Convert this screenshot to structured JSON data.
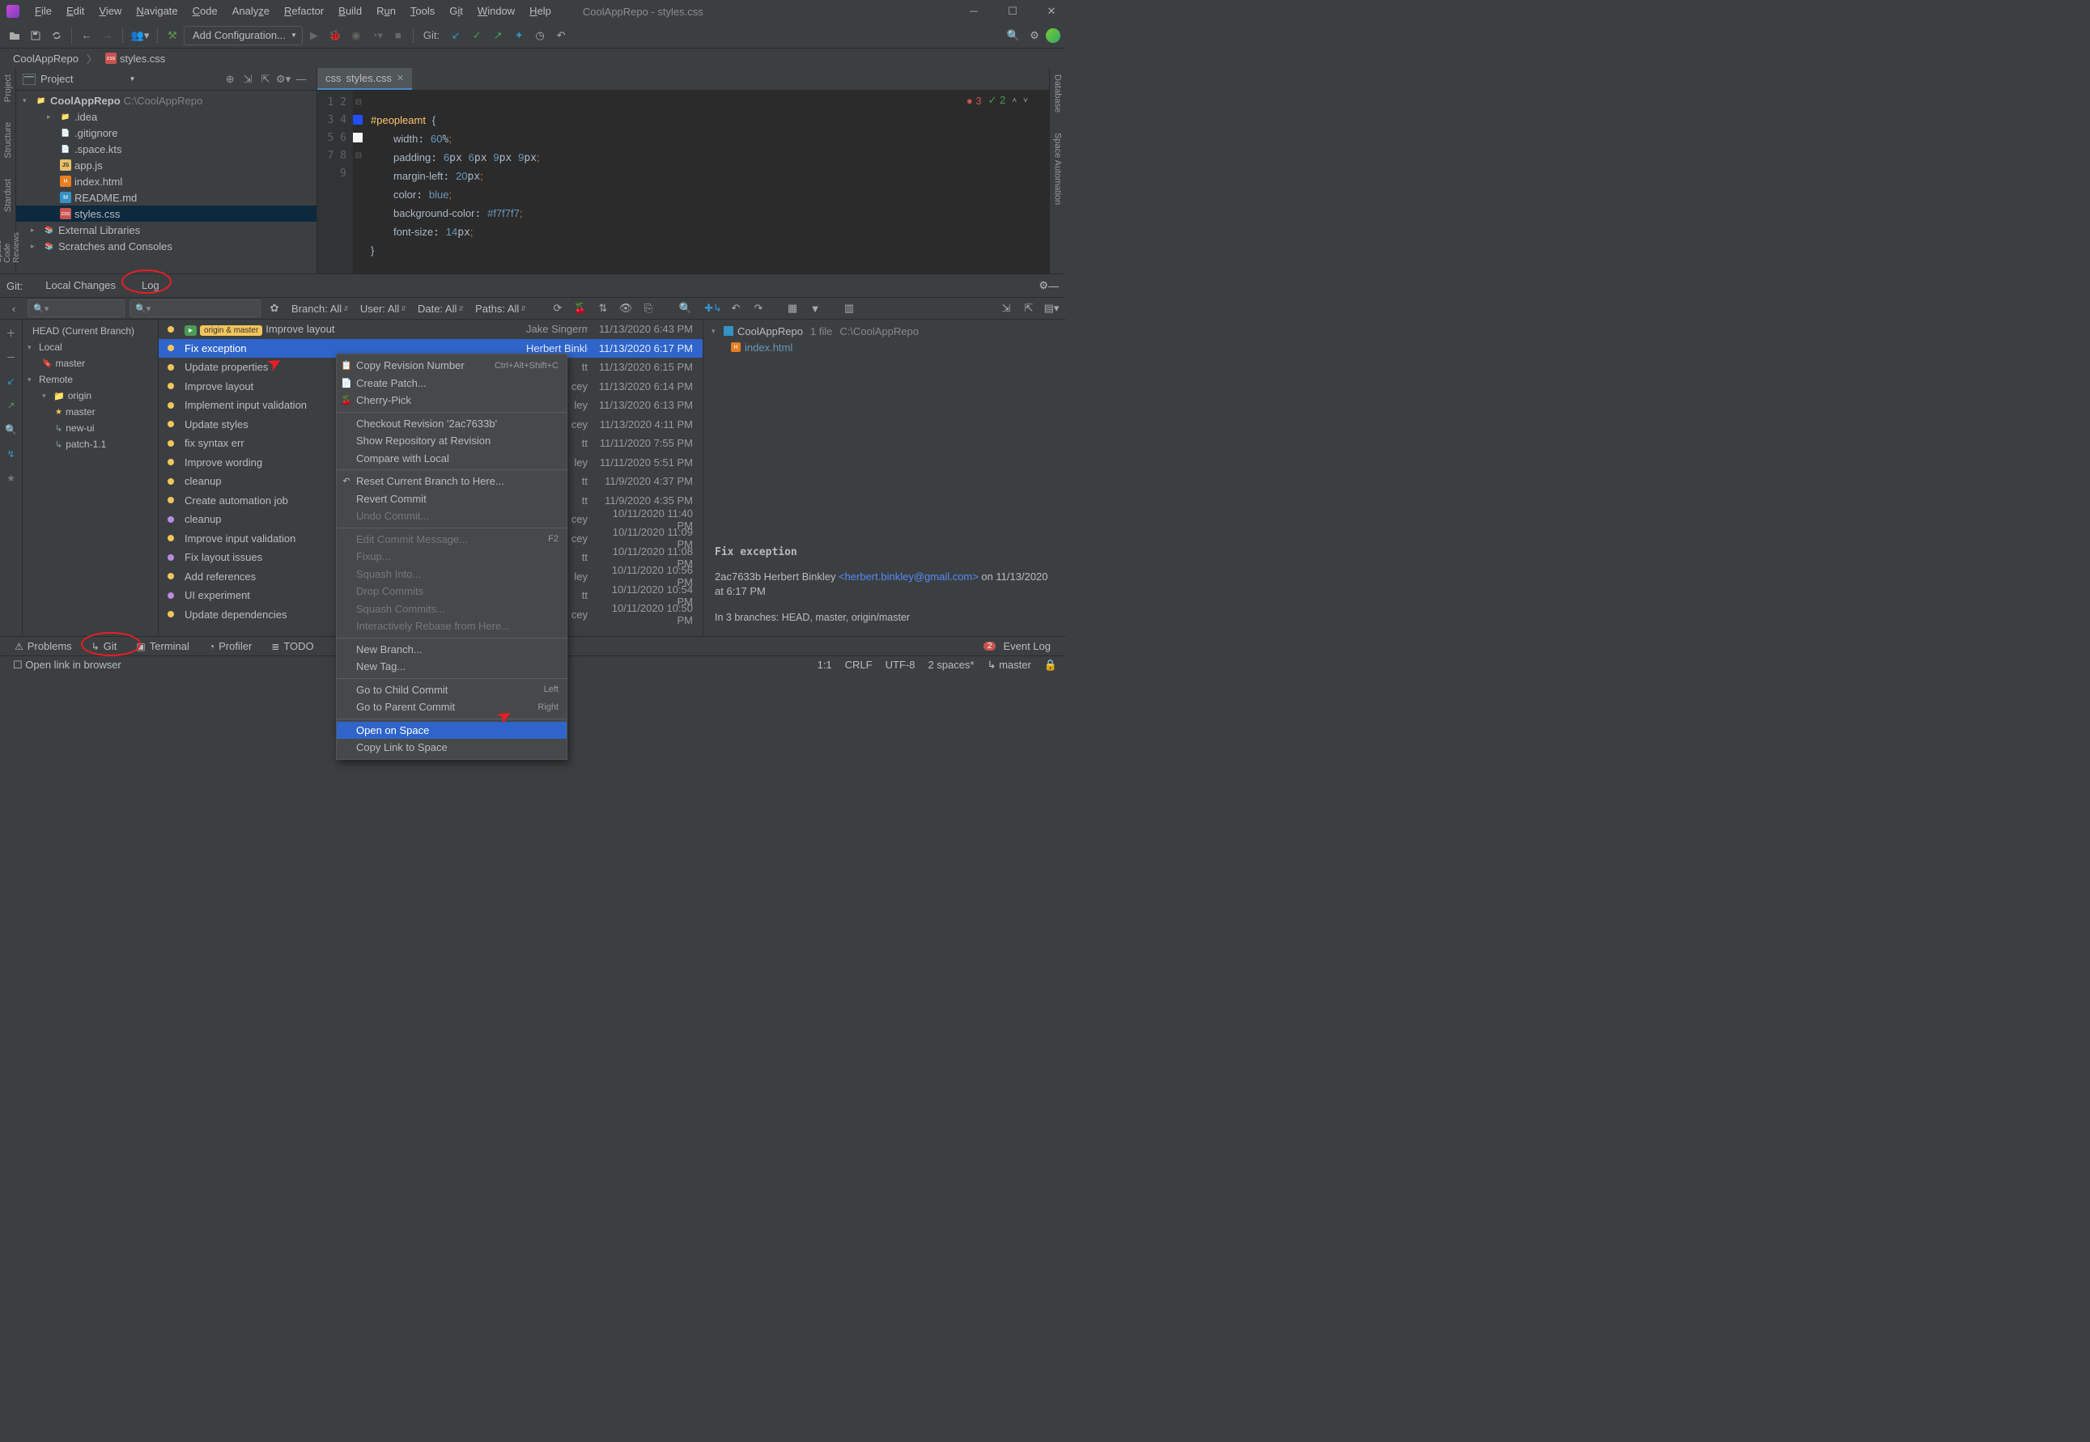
{
  "window": {
    "title": "CoolAppRepo - styles.css"
  },
  "menus": [
    "File",
    "Edit",
    "View",
    "Navigate",
    "Code",
    "Analyze",
    "Refactor",
    "Build",
    "Run",
    "Tools",
    "Git",
    "Window",
    "Help"
  ],
  "run_config": "Add Configuration...",
  "git_label": "Git:",
  "breadcrumb": {
    "root": "CoolAppRepo",
    "file": "styles.css"
  },
  "project_panel": {
    "title": "Project"
  },
  "tree": {
    "root": "CoolAppRepo",
    "root_path": "C:\\CoolAppRepo",
    "children": [
      {
        "name": ".idea",
        "type": "folder",
        "expandable": true
      },
      {
        "name": ".gitignore",
        "type": "txt"
      },
      {
        "name": ".space.kts",
        "type": "txt"
      },
      {
        "name": "app.js",
        "type": "js"
      },
      {
        "name": "index.html",
        "type": "html"
      },
      {
        "name": "README.md",
        "type": "md"
      },
      {
        "name": "styles.css",
        "type": "css",
        "selected": true
      }
    ],
    "extras": [
      {
        "name": "External Libraries",
        "icon": "lib"
      },
      {
        "name": "Scratches and Consoles",
        "icon": "scratch"
      }
    ]
  },
  "editor": {
    "tab": "styles.css",
    "errors": "3",
    "warnings": "2",
    "lines": [
      {
        "n": 1,
        "raw": ""
      },
      {
        "n": 2,
        "selector": "#peopleamt",
        "brace": "{"
      },
      {
        "n": 3,
        "prop": "width",
        "val": "60",
        "unit": "%"
      },
      {
        "n": 4,
        "prop": "padding",
        "vals": [
          "6px",
          "6px",
          "9px",
          "9px"
        ]
      },
      {
        "n": 5,
        "prop": "margin-left",
        "val": "20",
        "unit": "px"
      },
      {
        "n": 6,
        "prop": "color",
        "kw": "blue",
        "swatch": "#1f4fff"
      },
      {
        "n": 7,
        "prop": "background-color",
        "hex": "#f7f7f7",
        "swatch": "#f7f7f7"
      },
      {
        "n": 8,
        "prop": "font-size",
        "val": "14",
        "unit": "px"
      },
      {
        "n": 9,
        "brace": "}"
      }
    ]
  },
  "side_left": [
    "Project",
    "Structure",
    "Stardust",
    "Space Code Reviews"
  ],
  "side_right": [
    "Database",
    "Space Automation"
  ],
  "git_panel": {
    "label": "Git:",
    "tabs": [
      "Local Changes",
      "Log"
    ],
    "filters": {
      "branch": "Branch: All",
      "user": "User: All",
      "date": "Date: All",
      "paths": "Paths: All"
    },
    "branch_tree": {
      "head": "HEAD (Current Branch)",
      "local": {
        "label": "Local",
        "items": [
          "master"
        ]
      },
      "remote": {
        "label": "Remote",
        "origin": "origin",
        "items": [
          "master",
          "new-ui",
          "patch-1.1"
        ]
      }
    },
    "commits": [
      {
        "msg": "Improve layout",
        "author": "Jake Singerman",
        "date": "11/13/2020 6:43 PM",
        "tags": [
          "origin & master"
        ]
      },
      {
        "msg": "Fix exception",
        "author": "Herbert Binkley",
        "date": "11/13/2020 6:17 PM",
        "sel": true
      },
      {
        "msg": "Update properties",
        "author": "tt",
        "date": "11/13/2020 6:15 PM"
      },
      {
        "msg": "Improve layout",
        "author": "cey",
        "date": "11/13/2020 6:14 PM"
      },
      {
        "msg": "Implement input validation",
        "author": "ley",
        "date": "11/13/2020 6:13 PM"
      },
      {
        "msg": "Update styles",
        "author": "cey",
        "date": "11/13/2020 4:11 PM"
      },
      {
        "msg": "fix syntax err",
        "author": "tt",
        "date": "11/11/2020 7:55 PM"
      },
      {
        "msg": "Improve wording",
        "author": "ley",
        "date": "11/11/2020 5:51 PM"
      },
      {
        "msg": "cleanup",
        "author": "tt",
        "date": "11/9/2020 4:37 PM"
      },
      {
        "msg": "Create automation job",
        "author": "tt",
        "date": "11/9/2020 4:35 PM"
      },
      {
        "msg": "cleanup",
        "author": "cey",
        "date": "10/11/2020 11:40 PM",
        "purple": true
      },
      {
        "msg": "Improve input validation",
        "author": "cey",
        "date": "10/11/2020 11:09 PM"
      },
      {
        "msg": "Fix layout issues",
        "author": "tt",
        "date": "10/11/2020 11:08 PM",
        "purple": true
      },
      {
        "msg": "Add references",
        "author": "ley",
        "date": "10/11/2020 10:56 PM"
      },
      {
        "msg": "UI experiment",
        "author": "tt",
        "date": "10/11/2020 10:54 PM",
        "purple": true
      },
      {
        "msg": "Update dependencies",
        "author": "cey",
        "date": "10/11/2020 10:50 PM"
      }
    ],
    "details": {
      "root": "CoolAppRepo",
      "count": "1 file",
      "path": "C:\\CoolAppRepo",
      "files": [
        "index.html"
      ],
      "title": "Fix exception",
      "hash": "2ac7633b",
      "author_name": "Herbert Binkley",
      "author_email": "<herbert.binkley@gmail.com>",
      "tail": "on 11/13/2020 at 6:17 PM",
      "branches": "In 3 branches: HEAD, master, origin/master"
    }
  },
  "context_menu": [
    {
      "label": "Copy Revision Number",
      "icon": "copy",
      "shortcut": "Ctrl+Alt+Shift+C"
    },
    {
      "label": "Create Patch...",
      "icon": "patch"
    },
    {
      "label": "Cherry-Pick",
      "icon": "cherry"
    },
    {
      "sep": true
    },
    {
      "label": "Checkout Revision '2ac7633b'"
    },
    {
      "label": "Show Repository at Revision "
    },
    {
      "label": "Compare with Local"
    },
    {
      "sep": true
    },
    {
      "label": "Reset Current Branch to Here...",
      "icon": "reset"
    },
    {
      "label": "Revert Commit"
    },
    {
      "label": "Undo Commit...",
      "disabled": true
    },
    {
      "sep": true
    },
    {
      "label": "Edit Commit Message...",
      "disabled": true,
      "shortcut": "F2"
    },
    {
      "label": "Fixup...",
      "disabled": true
    },
    {
      "label": "Squash Into...",
      "disabled": true
    },
    {
      "label": "Drop Commits",
      "disabled": true
    },
    {
      "label": "Squash Commits...",
      "disabled": true
    },
    {
      "label": "Interactively Rebase from Here...",
      "disabled": true
    },
    {
      "sep": true
    },
    {
      "label": "New Branch..."
    },
    {
      "label": "New Tag..."
    },
    {
      "sep": true
    },
    {
      "label": "Go to Child Commit",
      "shortcut": "Left"
    },
    {
      "label": "Go to Parent Commit",
      "shortcut": "Right"
    },
    {
      "sep": true
    },
    {
      "label": "Open on Space",
      "icon": "space",
      "highlighted": true
    },
    {
      "label": "Copy Link to Space",
      "icon": "space"
    }
  ],
  "bottom_tools": [
    "Problems",
    "Git",
    "Terminal",
    "Profiler",
    "TODO"
  ],
  "event_log": "Event Log",
  "status": {
    "hint": "Open link in browser",
    "pos": "1:1",
    "eol": "CRLF",
    "enc": "UTF-8",
    "indent": "2 spaces*",
    "branch": "master"
  }
}
